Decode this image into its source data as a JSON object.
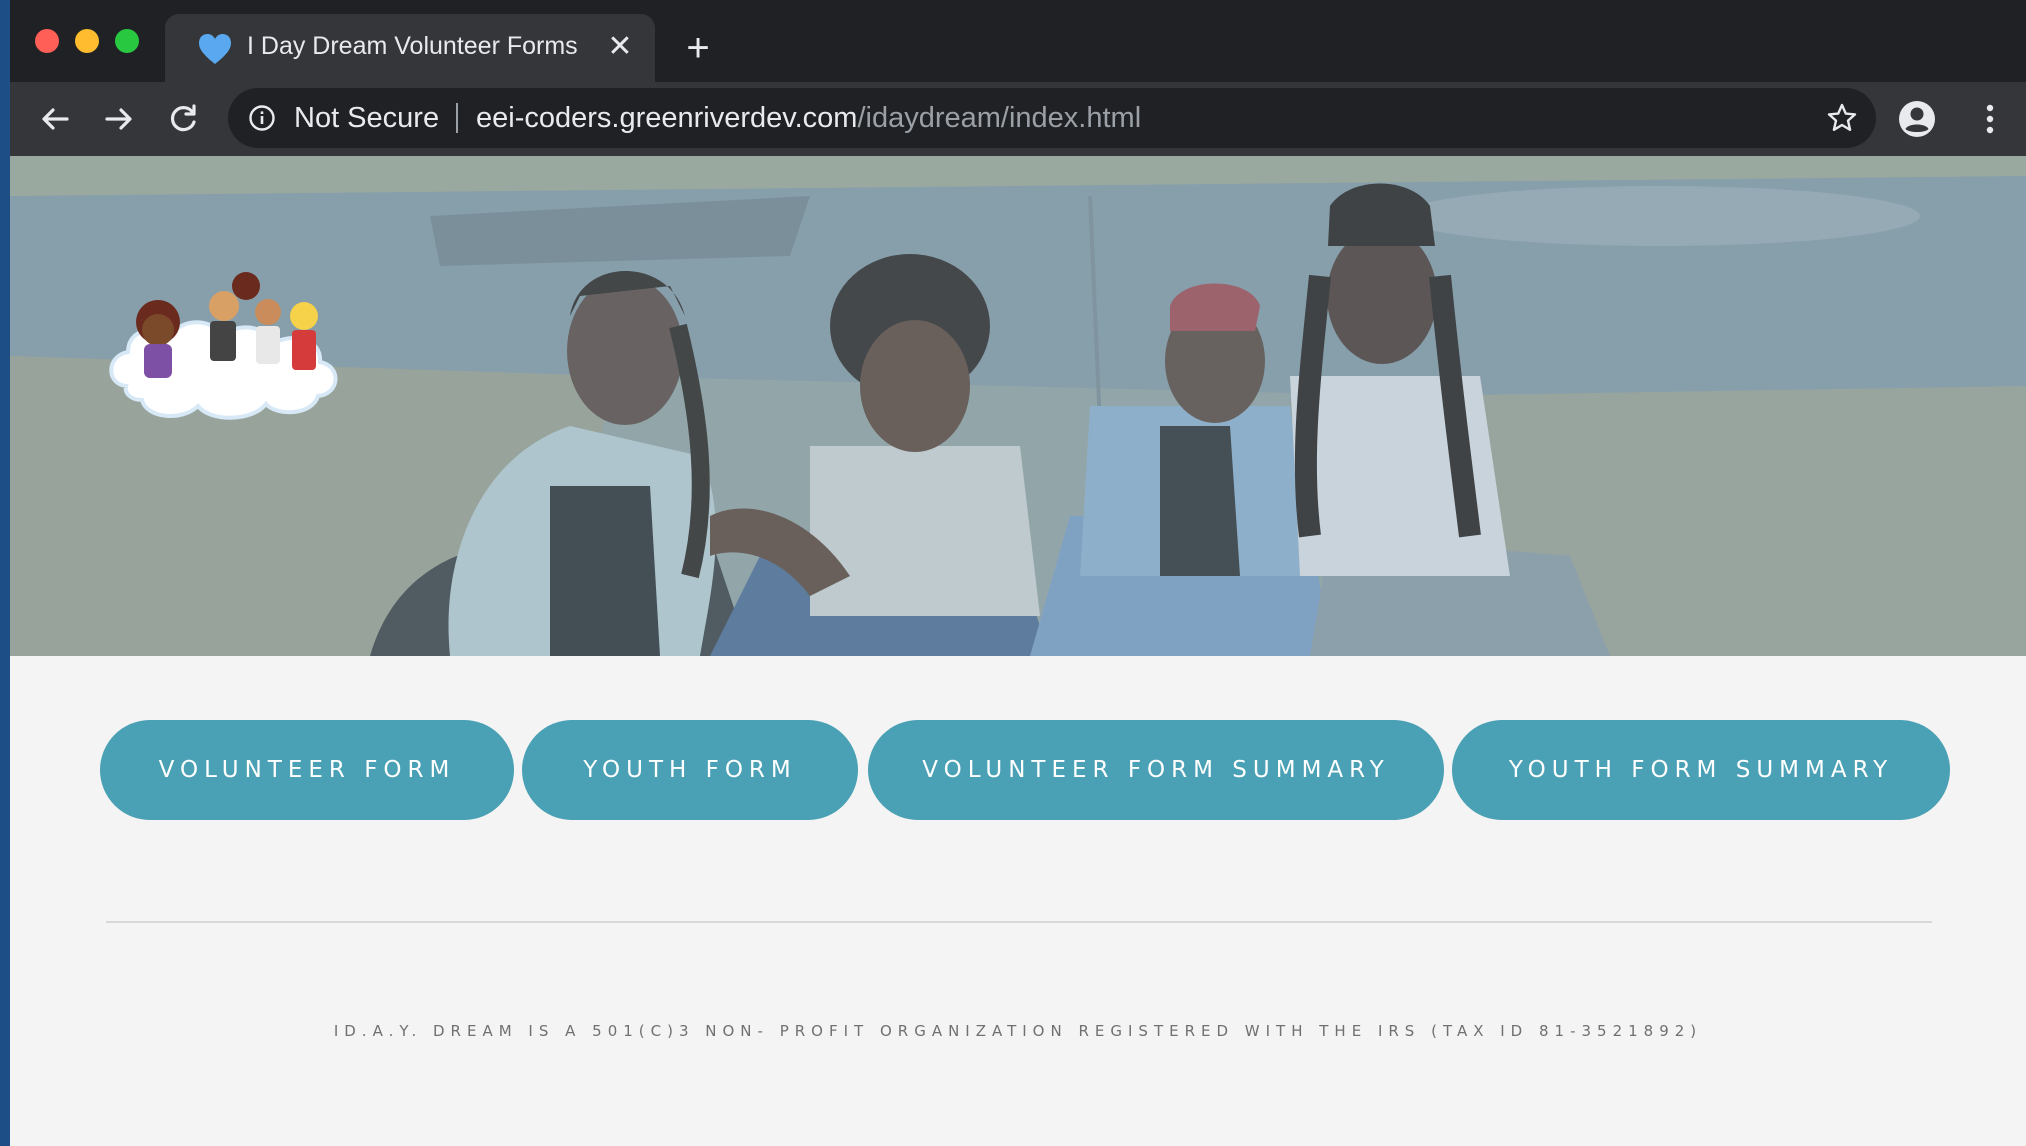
{
  "browser": {
    "tab": {
      "title": "I Day Dream Volunteer Forms",
      "favicon": "heart-icon",
      "close_icon": "close-icon"
    },
    "new_tab_icon": "plus-icon",
    "toolbar": {
      "back_icon": "back-arrow-icon",
      "forward_icon": "forward-arrow-icon",
      "reload_icon": "reload-icon",
      "security_label": "Not Secure",
      "url_host": "eei-coders.greenriverdev.com",
      "url_path": "/idaydream/index.html",
      "bookmark_icon": "star-icon",
      "profile_icon": "account-icon",
      "menu_icon": "kebab-menu-icon"
    }
  },
  "page": {
    "hero": {
      "image": "four-girls-sitting-on-pavement-photo",
      "logo": "cloud-kids-logo"
    },
    "nav": [
      {
        "label": "VOLUNTEER FORM"
      },
      {
        "label": "YOUTH FORM"
      },
      {
        "label": "VOLUNTEER FORM SUMMARY"
      },
      {
        "label": "YOUTH FORM SUMMARY"
      }
    ],
    "footer": "ID.A.Y. DREAM IS A 501(C)3 NON- PROFIT ORGANIZATION REGISTERED WITH THE IRS (TAX ID 81-3521892)"
  },
  "colors": {
    "chrome_dark": "#202124",
    "chrome_toolbar": "#35363a",
    "button_teal": "#4aa0b4",
    "page_bg": "#f4f4f4"
  }
}
